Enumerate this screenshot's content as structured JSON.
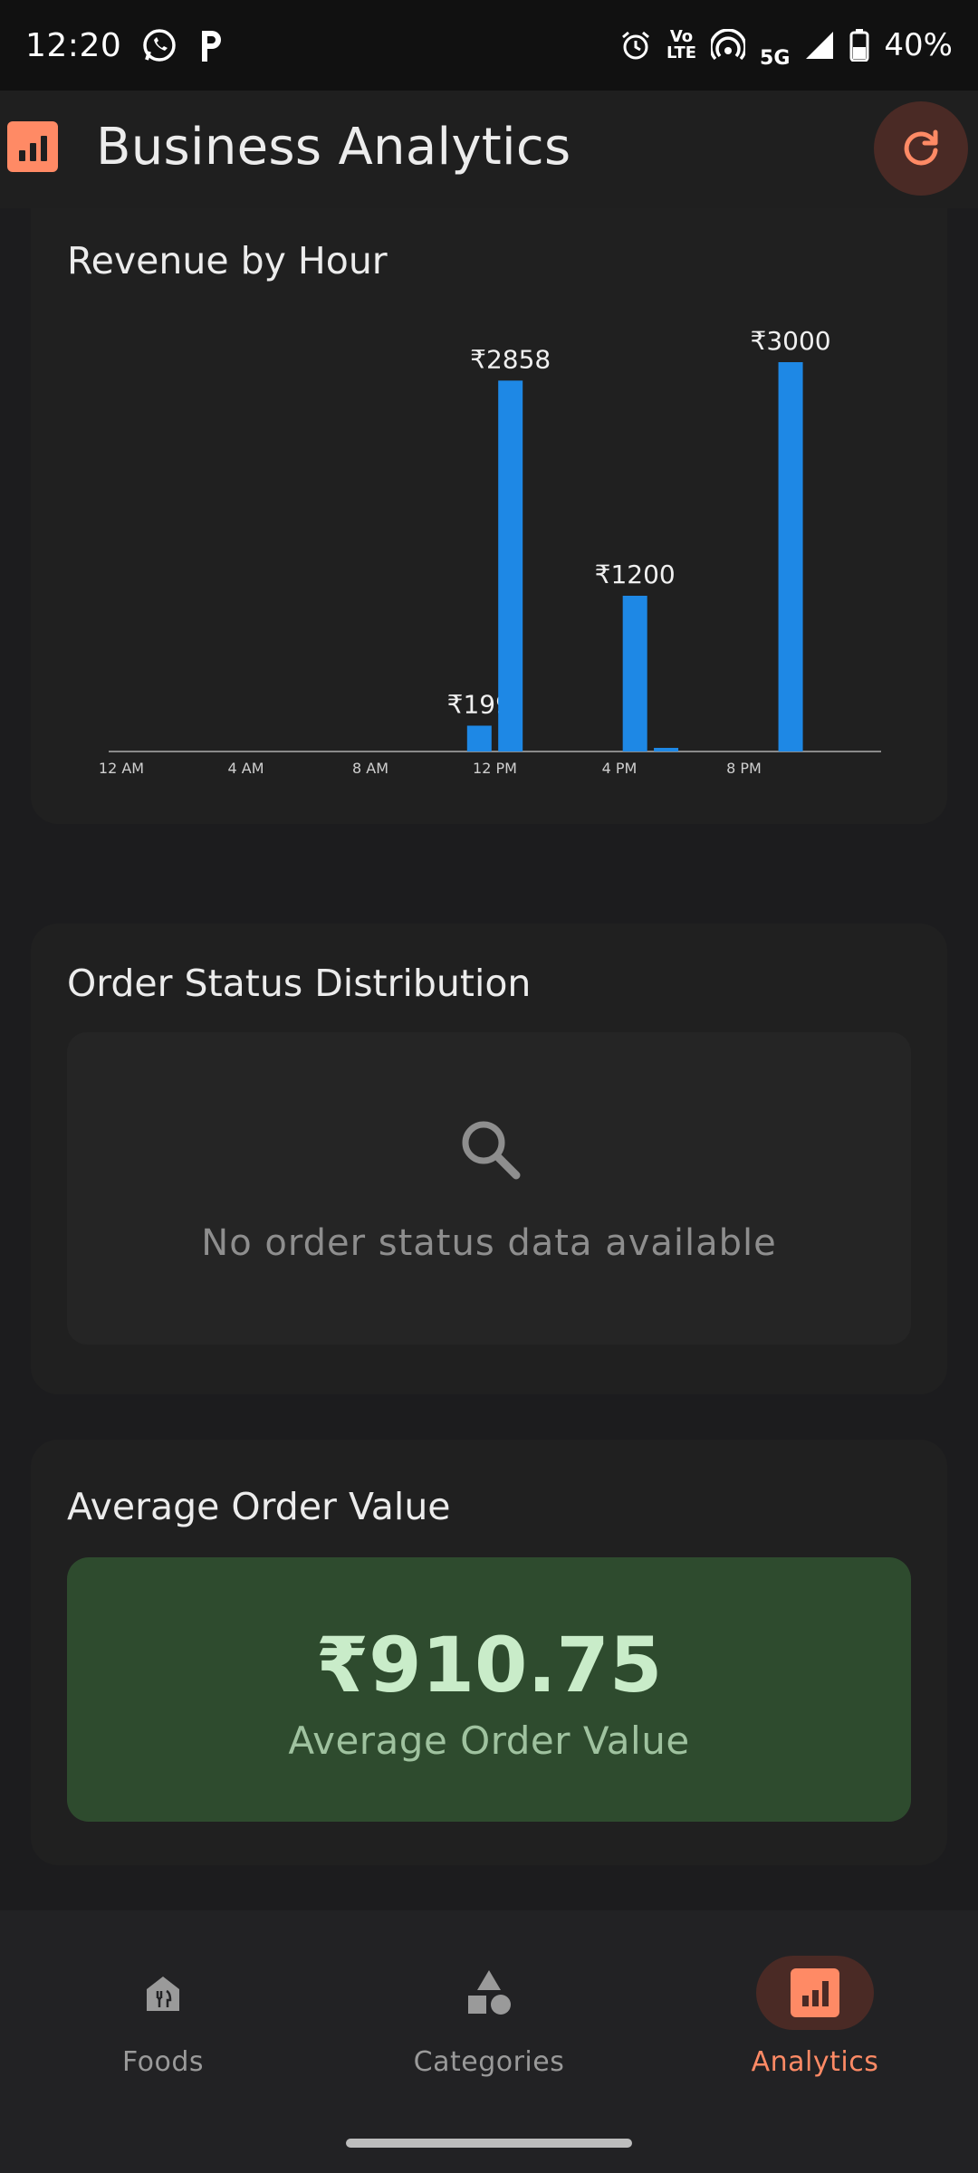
{
  "status_bar": {
    "time": "12:20",
    "battery": "40%",
    "network": "5G",
    "volte_top": "Vo",
    "volte_bottom": "LTE"
  },
  "app_bar": {
    "title": "Business Analytics"
  },
  "revenue": {
    "title": "Revenue by Hour"
  },
  "chart_data": {
    "type": "bar",
    "title": "Revenue by Hour",
    "x_ticks": [
      "12 AM",
      "4 AM",
      "8 AM",
      "12 PM",
      "4 PM",
      "8 PM"
    ],
    "x_tick_hours": [
      0,
      4,
      8,
      12,
      16,
      20
    ],
    "bars": [
      {
        "hour": 11,
        "value": 199,
        "label": "₹199"
      },
      {
        "hour": 12,
        "value": 2858,
        "label": "₹2858"
      },
      {
        "hour": 16,
        "value": 1200,
        "label": "₹1200"
      },
      {
        "hour": 17,
        "value": 20,
        "label": ""
      },
      {
        "hour": 21,
        "value": 3000,
        "label": "₹3000"
      }
    ],
    "x_range": [
      0,
      24
    ],
    "y_range": [
      0,
      3000
    ],
    "bar_color": "#1e88e5"
  },
  "order_status": {
    "title": "Order Status Distribution",
    "empty_message": "No order status data available"
  },
  "average_order": {
    "title": "Average Order Value",
    "value": "₹910.75",
    "label": "Average Order Value"
  },
  "nav": {
    "items": [
      {
        "label": "Foods",
        "icon": "restaurant-icon"
      },
      {
        "label": "Categories",
        "icon": "category-icon"
      },
      {
        "label": "Analytics",
        "icon": "analytics-icon"
      }
    ],
    "active": "Analytics"
  },
  "colors": {
    "accent": "#ff8a65",
    "bar": "#1e88e5",
    "aov_bg": "#2e4b2e"
  }
}
